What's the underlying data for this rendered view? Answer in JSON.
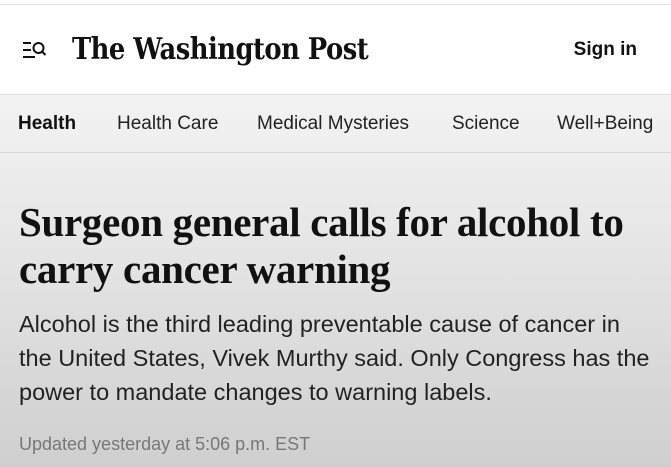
{
  "masthead": {
    "logo_text": "The Washington Post",
    "sign_in_label": "Sign in",
    "menu_icon": "menu-search-icon"
  },
  "subnav": {
    "items": [
      {
        "label": "Health",
        "active": true
      },
      {
        "label": "Health Care",
        "active": false
      },
      {
        "label": "Medical Mysteries",
        "active": false
      },
      {
        "label": "Science",
        "active": false
      },
      {
        "label": "Well+Being",
        "active": false
      }
    ]
  },
  "article": {
    "headline": "Surgeon general calls for alcohol to carry cancer warning",
    "dek": "Alcohol is the third leading preventable cause of cancer in the United States, Vivek Murthy said. Only Congress has the power to mandate changes to warning labels.",
    "timestamp": "Updated yesterday at 5:06 p.m. EST"
  },
  "colors": {
    "text": "#111111",
    "timestamp": "#777777",
    "background_top": "#f3f3f3",
    "background_bottom": "#cfcfcf"
  }
}
